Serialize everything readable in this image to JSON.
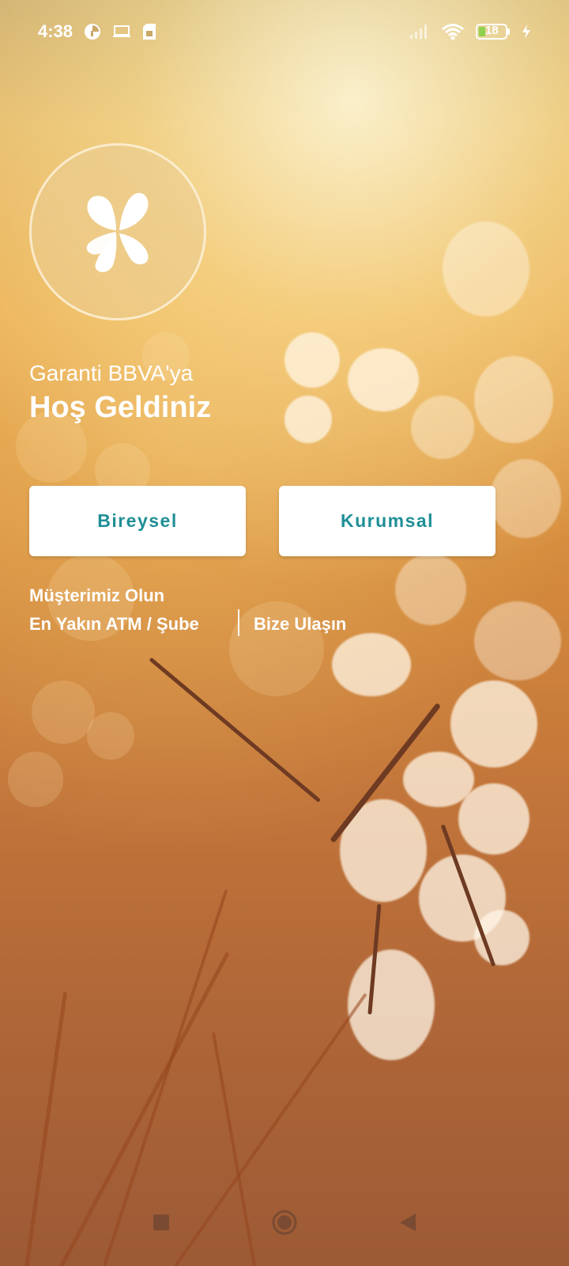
{
  "status_bar": {
    "time": "4:38",
    "battery": "18",
    "left_icons": [
      "data-saver-icon",
      "laptop-icon",
      "sim-icon"
    ],
    "right_icons": [
      "signal-icon",
      "wifi-icon",
      "battery-icon",
      "charging-icon"
    ]
  },
  "logo": {
    "icon": "garanti-clover-logo"
  },
  "welcome": {
    "subtitle": "Garanti BBVA'ya",
    "title": "Hoş Geldiniz"
  },
  "buttons": {
    "bireysel": "Bireysel",
    "kurumsal": "Kurumsal"
  },
  "links": {
    "musteri": "Müşterimiz Olun",
    "atm": "En Yakın ATM / Şube",
    "bize": "Bize Ulaşın"
  },
  "nav_bar": {
    "icons": [
      "recents-square-icon",
      "home-circle-icon",
      "back-triangle-icon"
    ]
  },
  "colors": {
    "button_text": "#1f8f96",
    "button_bg": "#ffffff",
    "text": "#ffffff"
  }
}
